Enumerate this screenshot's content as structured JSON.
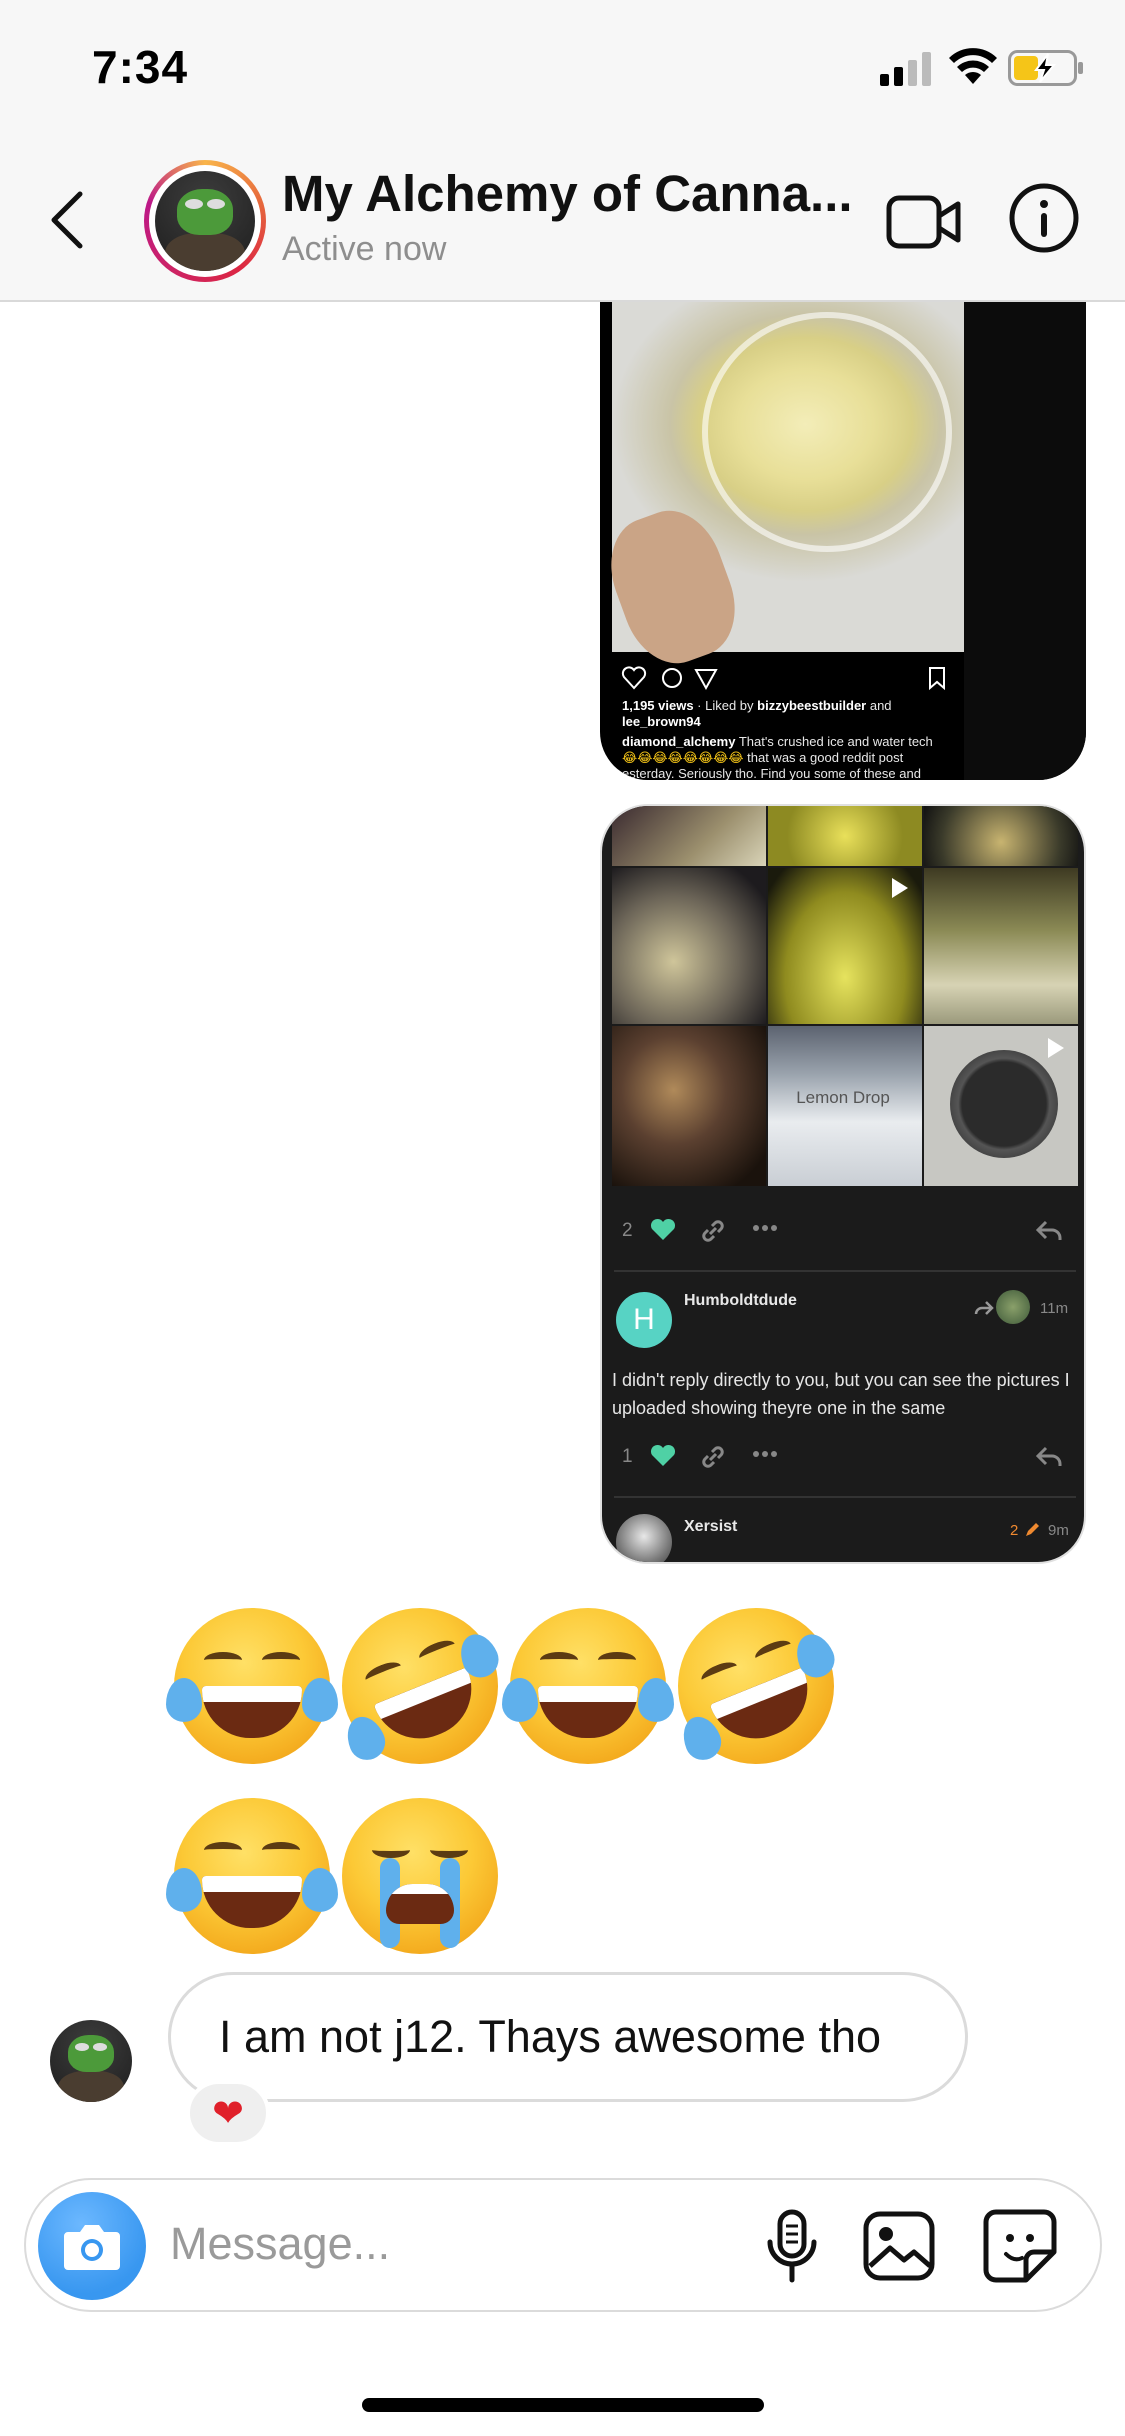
{
  "status_bar": {
    "time": "7:34"
  },
  "header": {
    "title": "My Alchemy of Canna...",
    "subtitle": "Active now"
  },
  "post1": {
    "views": "1,195 views",
    "liked_by_prefix": " · Liked by ",
    "liked_by_user": "bizzybeestbuilder",
    "liked_by_and": " and",
    "liked_by_user2": "lee_brown94",
    "caption_user": "diamond_alchemy",
    "caption_text": " That's crushed ice and water tech",
    "caption_line2": "that was a good reddit post",
    "caption_line3": "esterday. Seriously tho. Find you some of these and"
  },
  "post2": {
    "lemon_label": "Lemon Drop",
    "row1_count": "2",
    "commenter1": "Humboldtdude",
    "commenter1_initial": "H",
    "commenter1_time": "11m",
    "comment1": "I didn't reply directly to you, but you can see the pictures I uploaded showing theyre one in the same",
    "row2_count": "1",
    "commenter2": "Xersist",
    "commenter2_count": "2",
    "commenter2_time": "9m"
  },
  "emojis": [
    "face-with-tears-of-joy",
    "rolling-on-floor-laughing",
    "face-with-tears-of-joy",
    "rolling-on-floor-laughing",
    "face-with-tears-of-joy",
    "loudly-crying-face"
  ],
  "message": {
    "text": "I am not j12. Thays awesome tho",
    "reaction": "❤"
  },
  "composer": {
    "placeholder": "Message..."
  },
  "colors": {
    "accent_blue": "#3897f0",
    "teal": "#57d3c4",
    "heart_green": "#4fd1a5",
    "reaction_red": "#e0202a"
  }
}
